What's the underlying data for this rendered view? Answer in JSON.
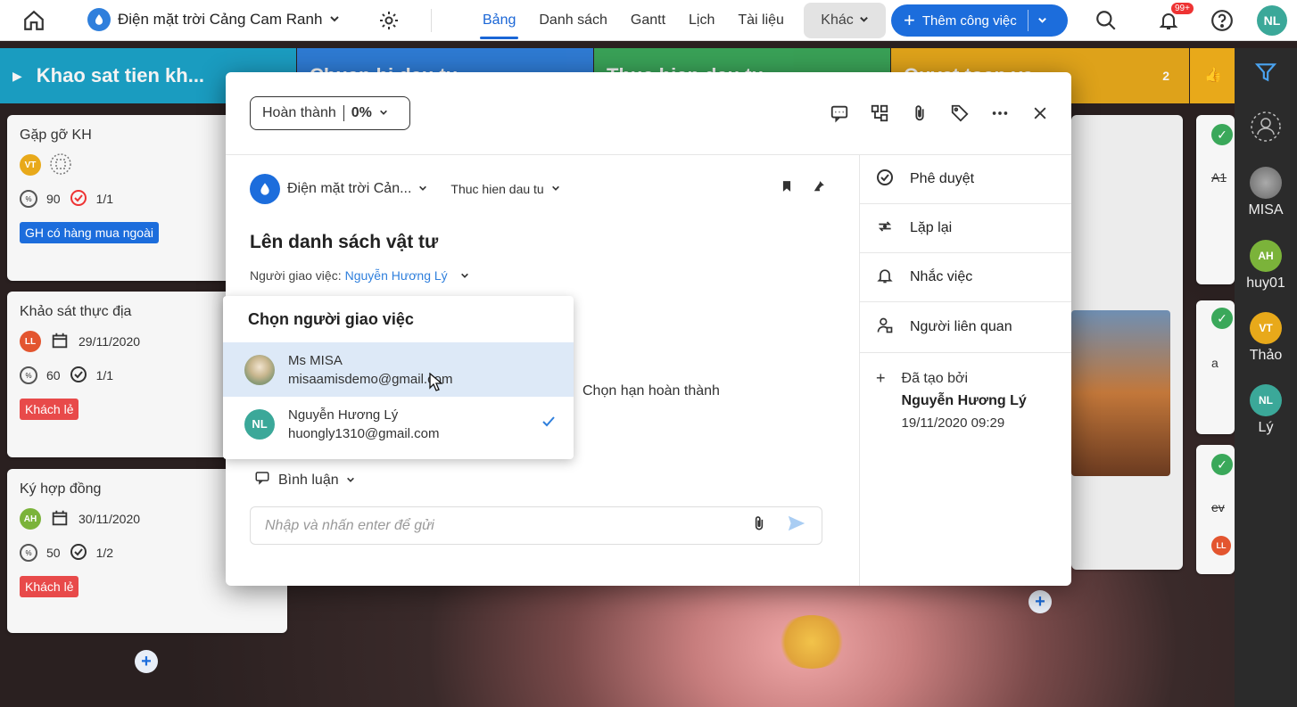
{
  "topbar": {
    "project_name": "Điện mặt trời Cảng Cam Ranh",
    "tabs": [
      {
        "label": "Bảng",
        "active": true
      },
      {
        "label": "Danh sách",
        "active": false
      },
      {
        "label": "Gantt",
        "active": false
      },
      {
        "label": "Lịch",
        "active": false
      },
      {
        "label": "Tài liệu",
        "active": false
      }
    ],
    "more_label": "Khác",
    "add_task_label": "Thêm công việc",
    "notification_badge": "99+",
    "user_initials": "NL"
  },
  "board": {
    "columns": [
      {
        "title": "Khao sat tien kh...",
        "color": "#1aa3c9"
      },
      {
        "title": "Chuan bi dau tu",
        "color": "#2f7fdc"
      },
      {
        "title": "Thuc hien dau tu",
        "color": "#3aa85a"
      },
      {
        "title": "Quyet toan va...",
        "color": "#e8a91a",
        "count": "2"
      }
    ],
    "cards": [
      {
        "title": "Gặp gỡ KH",
        "assignee": "VT",
        "assignee_color": "#e8a91a",
        "date": "",
        "progress": "90",
        "checklist": "1/1",
        "tag": "GH có hàng mua ngoài",
        "tag_color": "#1c6ddc"
      },
      {
        "title": "Khảo sát thực địa",
        "assignee": "LL",
        "assignee_color": "#e3552f",
        "date": "29/11/2020",
        "progress": "60",
        "checklist": "1/1",
        "tag": "Khách lẻ",
        "tag_color": "#e84a4a"
      },
      {
        "title": "Ký hợp đồng",
        "assignee": "AH",
        "assignee_color": "#7bb33a",
        "date": "30/11/2020",
        "progress": "50",
        "checklist": "1/2",
        "tag": "Khách lẻ",
        "tag_color": "#e84a4a"
      }
    ],
    "right_snippets": [
      "A1",
      "a",
      "ev"
    ],
    "rail_users": [
      {
        "label": "MISA",
        "initials": "",
        "color": "#777"
      },
      {
        "label": "huy01",
        "initials": "AH",
        "color": "#7bb33a"
      },
      {
        "label": "Thảo",
        "initials": "VT",
        "color": "#e8a91a"
      },
      {
        "label": "Lý",
        "initials": "NL",
        "color": "#3ba899"
      }
    ]
  },
  "modal": {
    "status_label": "Hoàn thành",
    "status_percent": "0%",
    "project_crumb": "Điện mặt trời Cản...",
    "stage_crumb": "Thuc hien dau tu",
    "task_title": "Lên danh sách vật tư",
    "assigner_label": "Người giao việc:",
    "assigner_name": "Nguyễn Hương Lý",
    "deadline_label": "Chọn hạn hoàn thành",
    "comment_label": "Bình luận",
    "comment_placeholder": "Nhập và nhấn enter để gửi",
    "sidebar": {
      "approve": "Phê duyệt",
      "repeat": "Lặp lại",
      "remind": "Nhắc việc",
      "related": "Người liên quan",
      "created_label": "Đã tạo bởi",
      "created_by": "Nguyễn Hương Lý",
      "created_at": "19/11/2020  09:29"
    }
  },
  "assigner_dropdown": {
    "title": "Chọn người giao việc",
    "options": [
      {
        "name": "Ms MISA",
        "email": "misaamisdemo@gmail.com",
        "initials": "",
        "color": "#9aa58a",
        "hovered": true,
        "selected": false
      },
      {
        "name": "Nguyễn Hương Lý",
        "email": "huongly1310@gmail.com",
        "initials": "NL",
        "color": "#3ba899",
        "hovered": false,
        "selected": true
      }
    ]
  }
}
